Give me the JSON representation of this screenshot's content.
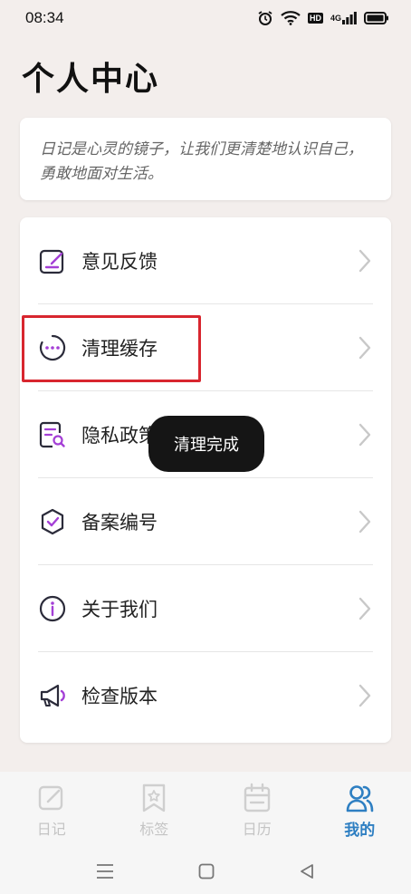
{
  "status_bar": {
    "time": "08:34",
    "icons": [
      "alarm-icon",
      "wifi-icon",
      "hd-icon",
      "signal-4g-icon",
      "battery-icon"
    ],
    "hd_label": "HD",
    "network_label": "4G"
  },
  "page_title": "个人中心",
  "quote": "日记是心灵的镜子，让我们更清楚地认识自己，勇敢地面对生活。",
  "menu": {
    "items": [
      {
        "label": "意见反馈",
        "icon": "feedback-icon"
      },
      {
        "label": "清理缓存",
        "icon": "clear-cache-icon"
      },
      {
        "label": "隐私政策",
        "icon": "privacy-policy-icon"
      },
      {
        "label": "备案编号",
        "icon": "record-number-icon"
      },
      {
        "label": "关于我们",
        "icon": "about-us-icon"
      },
      {
        "label": "检查版本",
        "icon": "check-version-icon"
      }
    ]
  },
  "toast": "清理完成",
  "tabs": [
    {
      "label": "日记",
      "icon": "diary-icon",
      "active": false
    },
    {
      "label": "标签",
      "icon": "tag-icon",
      "active": false
    },
    {
      "label": "日历",
      "icon": "calendar-icon",
      "active": false
    },
    {
      "label": "我的",
      "icon": "profile-icon",
      "active": true
    }
  ],
  "colors": {
    "accent": "#2e7fc2",
    "icon_purple": "#a43fd6",
    "icon_dark": "#2b2b3a",
    "highlight_red": "#d8262f",
    "background": "#f3eeec"
  }
}
